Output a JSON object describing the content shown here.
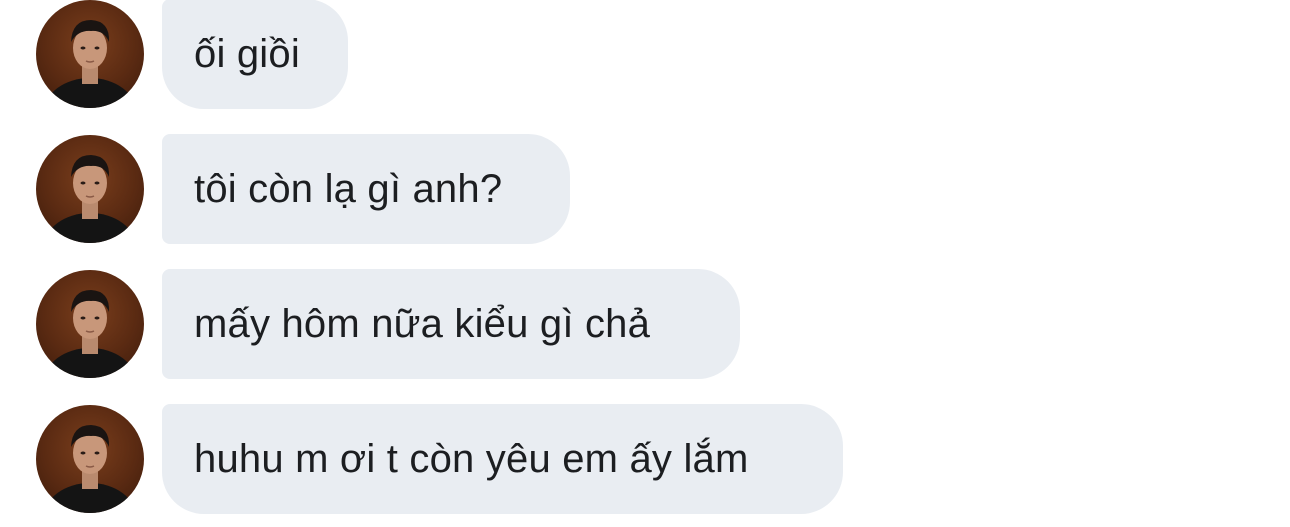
{
  "chat": {
    "messages": [
      {
        "text": "ối giồi",
        "avatar_icon": "profile-photo"
      },
      {
        "text": "tôi còn lạ gì anh?",
        "avatar_icon": "profile-photo"
      },
      {
        "text": "mấy hôm nữa kiểu gì chả",
        "avatar_icon": "profile-photo"
      },
      {
        "text": "huhu m ơi t còn yêu em ấy lắm",
        "avatar_icon": "profile-photo"
      }
    ],
    "colors": {
      "bubble_bg": "#e9edf2",
      "text": "#1c1e21",
      "avatar_bg": "#5a2a12"
    }
  }
}
